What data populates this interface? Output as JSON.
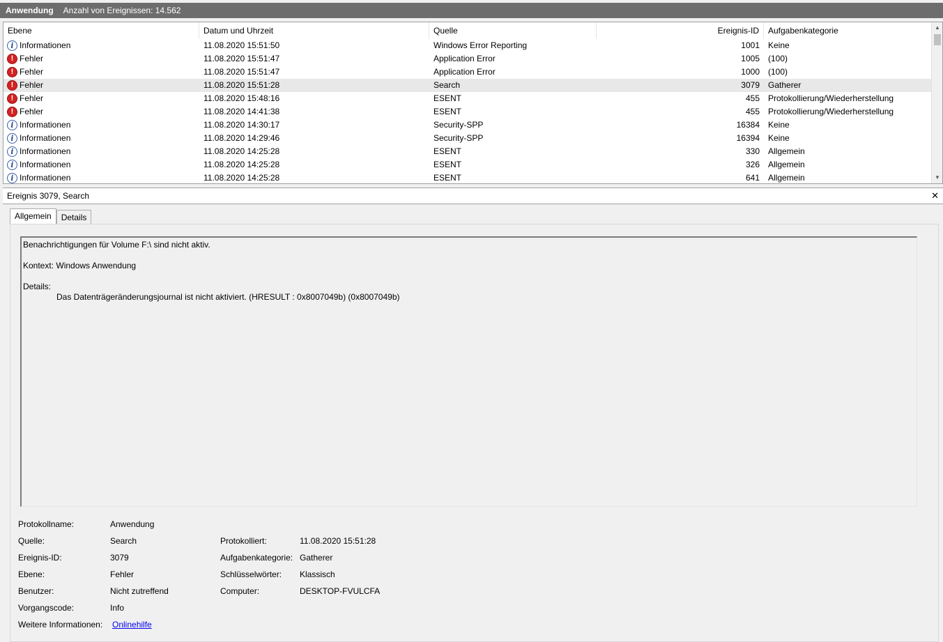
{
  "titlebar": {
    "log_name": "Anwendung",
    "event_count": "Anzahl von Ereignissen: 14.562"
  },
  "columns": [
    "Ebene",
    "Datum und Uhrzeit",
    "Quelle",
    "Ereignis-ID",
    "Aufgabenkategorie"
  ],
  "rows": [
    {
      "level": "Informationen",
      "type": "info",
      "date": "11.08.2020 15:51:50",
      "source": "Windows Error Reporting",
      "id": "1001",
      "category": "Keine"
    },
    {
      "level": "Fehler",
      "type": "error",
      "date": "11.08.2020 15:51:47",
      "source": "Application Error",
      "id": "1005",
      "category": "(100)"
    },
    {
      "level": "Fehler",
      "type": "error",
      "date": "11.08.2020 15:51:47",
      "source": "Application Error",
      "id": "1000",
      "category": "(100)"
    },
    {
      "level": "Fehler",
      "type": "error",
      "date": "11.08.2020 15:51:28",
      "source": "Search",
      "id": "3079",
      "category": "Gatherer",
      "selected": true
    },
    {
      "level": "Fehler",
      "type": "error",
      "date": "11.08.2020 15:48:16",
      "source": "ESENT",
      "id": "455",
      "category": "Protokollierung/Wiederherstellung"
    },
    {
      "level": "Fehler",
      "type": "error",
      "date": "11.08.2020 14:41:38",
      "source": "ESENT",
      "id": "455",
      "category": "Protokollierung/Wiederherstellung"
    },
    {
      "level": "Informationen",
      "type": "info",
      "date": "11.08.2020 14:30:17",
      "source": "Security-SPP",
      "id": "16384",
      "category": "Keine"
    },
    {
      "level": "Informationen",
      "type": "info",
      "date": "11.08.2020 14:29:46",
      "source": "Security-SPP",
      "id": "16394",
      "category": "Keine"
    },
    {
      "level": "Informationen",
      "type": "info",
      "date": "11.08.2020 14:25:28",
      "source": "ESENT",
      "id": "330",
      "category": "Allgemein"
    },
    {
      "level": "Informationen",
      "type": "info",
      "date": "11.08.2020 14:25:28",
      "source": "ESENT",
      "id": "326",
      "category": "Allgemein"
    },
    {
      "level": "Informationen",
      "type": "info",
      "date": "11.08.2020 14:25:28",
      "source": "ESENT",
      "id": "641",
      "category": "Allgemein"
    }
  ],
  "detail": {
    "title": "Ereignis 3079, Search",
    "close": "✕",
    "tabs": [
      "Allgemein",
      "Details"
    ],
    "message": {
      "line1": "Benachrichtigungen für Volume F:\\ sind nicht aktiv.",
      "context": "Kontext: Windows Anwendung",
      "details_label": "Details:",
      "details_text": "Das Datenträgeränderungsjournal ist nicht aktiviert.  (HRESULT : 0x8007049b) (0x8007049b)"
    },
    "properties": {
      "protokollname_label": "Protokollname:",
      "protokollname": "Anwendung",
      "quelle_label": "Quelle:",
      "quelle": "Search",
      "protokolliert_label": "Protokolliert:",
      "protokolliert": "11.08.2020 15:51:28",
      "ereignis_id_label": "Ereignis-ID:",
      "ereignis_id": "3079",
      "aufgabenkategorie_label": "Aufgabenkategorie:",
      "aufgabenkategorie": "Gatherer",
      "ebene_label": "Ebene:",
      "ebene": "Fehler",
      "schluesselwoerter_label": "Schlüsselwörter:",
      "schluesselwoerter": "Klassisch",
      "benutzer_label": "Benutzer:",
      "benutzer": "Nicht zutreffend",
      "computer_label": "Computer:",
      "computer": "DESKTOP-FVULCFA",
      "vorgangscode_label": "Vorgangscode:",
      "vorgangscode": "Info",
      "weitere_label": "Weitere Informationen:",
      "weitere_link": "Onlinehilfe"
    }
  }
}
